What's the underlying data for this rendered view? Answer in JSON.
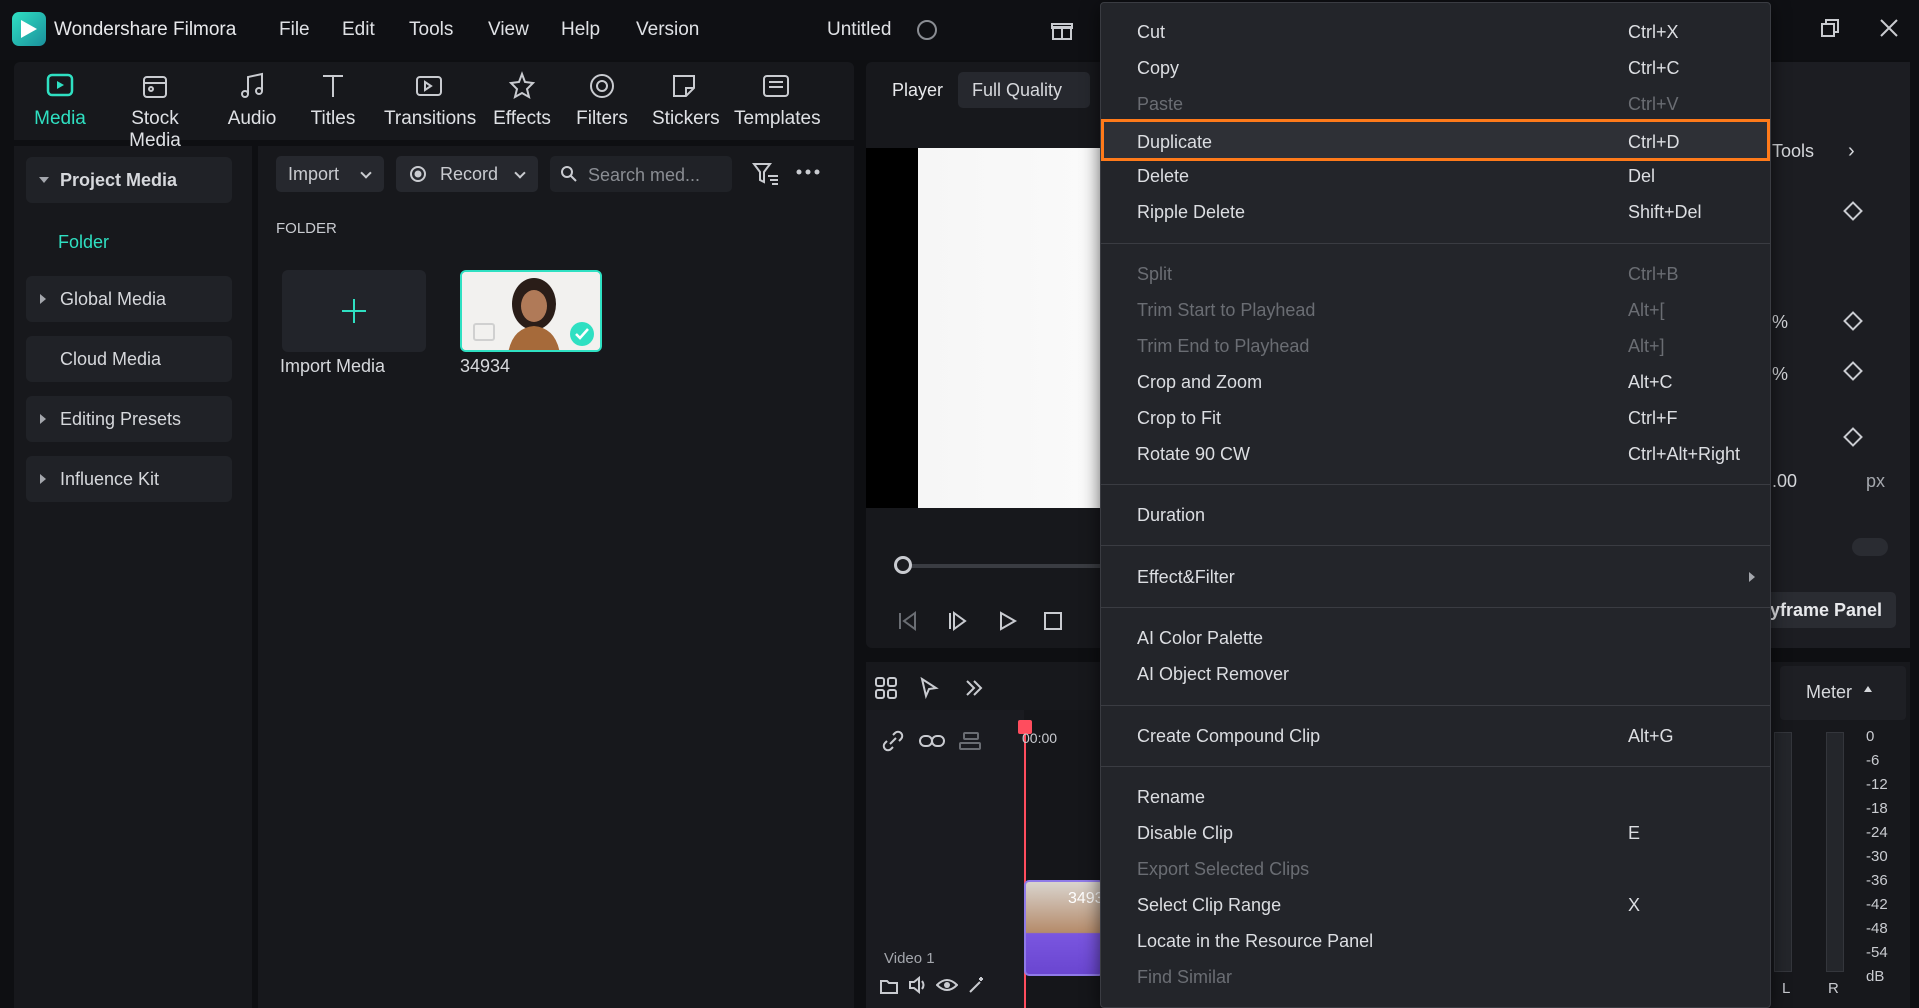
{
  "app": {
    "name": "Wondershare Filmora",
    "doc_title": "Untitled"
  },
  "menus": [
    "File",
    "Edit",
    "Tools",
    "View",
    "Help",
    "Version"
  ],
  "tabs": [
    {
      "label": "Media",
      "icon": "media-icon",
      "active": true
    },
    {
      "label": "Stock Media",
      "icon": "stock-media-icon"
    },
    {
      "label": "Audio",
      "icon": "music-note-icon"
    },
    {
      "label": "Titles",
      "icon": "text-t-icon"
    },
    {
      "label": "Transitions",
      "icon": "transition-icon"
    },
    {
      "label": "Effects",
      "icon": "effects-icon"
    },
    {
      "label": "Filters",
      "icon": "filter-icon"
    },
    {
      "label": "Stickers",
      "icon": "sticker-icon"
    },
    {
      "label": "Templates",
      "icon": "template-icon"
    }
  ],
  "sidebar": {
    "items": [
      {
        "label": "Project Media",
        "expanded": true
      },
      {
        "label": "Global Media"
      },
      {
        "label": "Cloud Media"
      },
      {
        "label": "Editing Presets"
      },
      {
        "label": "Influence Kit"
      }
    ],
    "folder": "Folder"
  },
  "media": {
    "import_label": "Import",
    "record_label": "Record",
    "search_placeholder": "Search med...",
    "section_label": "FOLDER",
    "import_tile_label": "Import Media",
    "clip_name": "34934"
  },
  "player": {
    "tab": "Player",
    "quality": "Full Quality"
  },
  "inspector": {
    "tools_label": "Tools",
    "percent1": "%",
    "percent2": "%",
    "value": ".00",
    "unit": "px",
    "keyframe_label": "yframe Panel"
  },
  "timeline": {
    "timecode": "00:00",
    "track_label": "Video 1",
    "clip_label": "3493"
  },
  "meter": {
    "label": "Meter",
    "db_scale": [
      "0",
      "-6",
      "-12",
      "-18",
      "-24",
      "-30",
      "-36",
      "-42",
      "-48",
      "-54",
      "dB"
    ],
    "channels": [
      "L",
      "R"
    ]
  },
  "context_menu": {
    "groups": [
      [
        {
          "label": "Cut",
          "shortcut": "Ctrl+X",
          "enabled": true
        },
        {
          "label": "Copy",
          "shortcut": "Ctrl+C",
          "enabled": true
        },
        {
          "label": "Paste",
          "shortcut": "Ctrl+V",
          "enabled": false
        },
        {
          "label": "Duplicate",
          "shortcut": "Ctrl+D",
          "enabled": true,
          "highlighted": true
        },
        {
          "label": "Delete",
          "shortcut": "Del",
          "enabled": true
        },
        {
          "label": "Ripple Delete",
          "shortcut": "Shift+Del",
          "enabled": true
        }
      ],
      [
        {
          "label": "Split",
          "shortcut": "Ctrl+B",
          "enabled": false
        },
        {
          "label": "Trim Start to Playhead",
          "shortcut": "Alt+[",
          "enabled": false
        },
        {
          "label": "Trim End to Playhead",
          "shortcut": "Alt+]",
          "enabled": false
        },
        {
          "label": "Crop and Zoom",
          "shortcut": "Alt+C",
          "enabled": true
        },
        {
          "label": "Crop to Fit",
          "shortcut": "Ctrl+F",
          "enabled": true
        },
        {
          "label": "Rotate 90 CW",
          "shortcut": "Ctrl+Alt+Right",
          "enabled": true
        }
      ],
      [
        {
          "label": "Duration",
          "shortcut": "",
          "enabled": true
        }
      ],
      [
        {
          "label": "Effect&Filter",
          "shortcut": "",
          "enabled": true,
          "submenu": true
        }
      ],
      [
        {
          "label": "AI Color Palette",
          "shortcut": "",
          "enabled": true
        },
        {
          "label": "AI Object Remover",
          "shortcut": "",
          "enabled": true
        }
      ],
      [
        {
          "label": "Create Compound Clip",
          "shortcut": "Alt+G",
          "enabled": true
        }
      ],
      [
        {
          "label": "Rename",
          "shortcut": "",
          "enabled": true
        },
        {
          "label": "Disable Clip",
          "shortcut": "E",
          "enabled": true
        },
        {
          "label": "Export Selected Clips",
          "shortcut": "",
          "enabled": false
        },
        {
          "label": "Select Clip Range",
          "shortcut": "X",
          "enabled": true
        },
        {
          "label": "Locate in the Resource Panel",
          "shortcut": "",
          "enabled": true
        },
        {
          "label": "Find Similar",
          "shortcut": "",
          "enabled": false
        }
      ]
    ]
  },
  "colors": {
    "accent": "#2fe0c2",
    "highlight_border": "#ff7a1a",
    "playhead": "#ff4d5e"
  }
}
